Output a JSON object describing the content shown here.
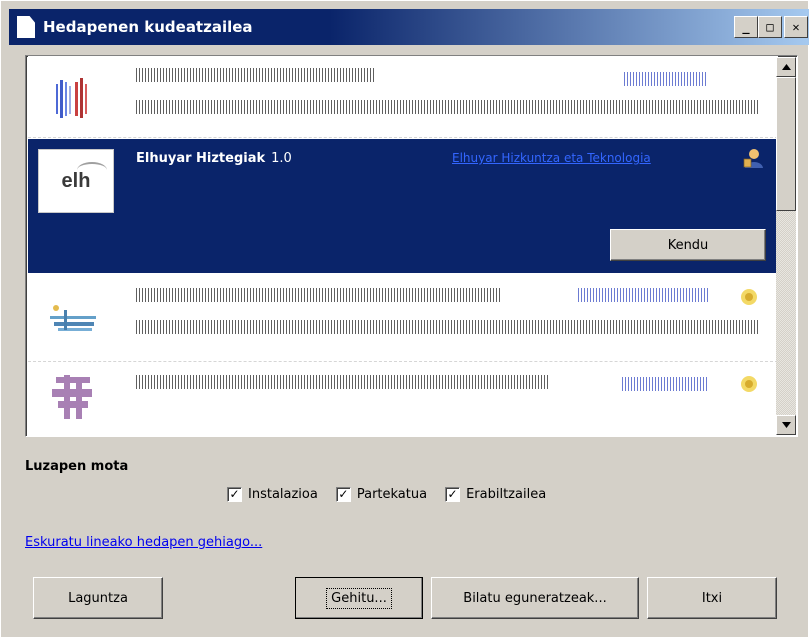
{
  "window": {
    "title": "Hedapenen kudeatzailea",
    "min_label": "_",
    "max_label": "□",
    "close_label": "✕"
  },
  "extensions": {
    "selected": {
      "name": "Elhuyar Hiztegiak",
      "version": "1.0",
      "publisher": "Elhuyar Hizkuntza eta Teknologia",
      "logo_text": "elh",
      "remove_label": "Kendu"
    }
  },
  "filter": {
    "label": "Luzapen mota",
    "options": [
      {
        "label": "Instalazioa",
        "checked": true
      },
      {
        "label": "Partekatua",
        "checked": true
      },
      {
        "label": "Erabiltzailea",
        "checked": true
      }
    ]
  },
  "link_more": "Eskuratu lineako hedapen gehiago...",
  "buttons": {
    "help": "Laguntza",
    "add": "Gehitu...",
    "updates": "Bilatu eguneratzeak...",
    "close": "Itxi"
  },
  "colors": {
    "selection": "#0a246a",
    "dialog_bg": "#d4d0c8",
    "link": "#0000ee"
  }
}
